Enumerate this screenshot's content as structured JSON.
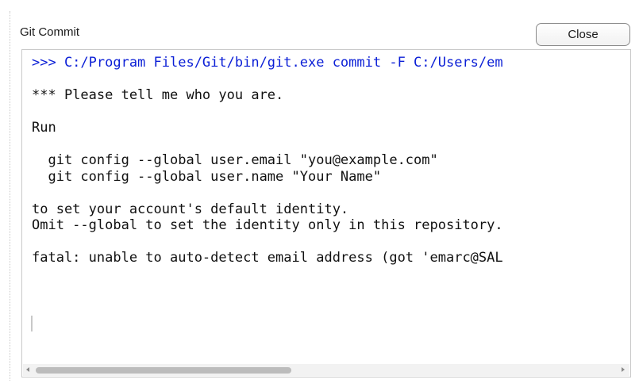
{
  "window": {
    "title": "Git Commit",
    "close_label": "Close"
  },
  "console": {
    "lines": [
      ">>> C:/Program Files/Git/bin/git.exe commit -F C:/Users/em",
      "",
      "*** Please tell me who you are.",
      "",
      "Run",
      "",
      "  git config --global user.email \"you@example.com\"",
      "  git config --global user.name \"Your Name\"",
      "",
      "to set your account's default identity.",
      "Omit --global to set the identity only in this repository.",
      "",
      "fatal: unable to auto-detect email address (got 'emarc@SAL"
    ],
    "command_color": "#0b1fd6"
  },
  "scrollbar": {
    "horizontal_position": 0.0,
    "visible_fraction": 0.44
  }
}
